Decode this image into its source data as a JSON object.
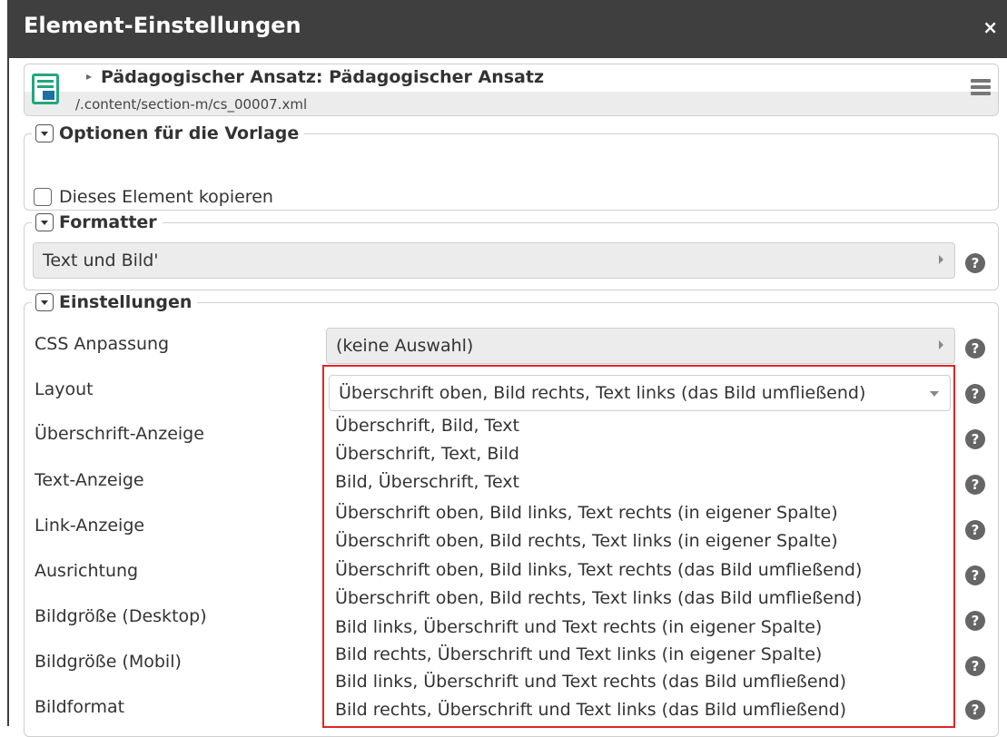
{
  "dialog": {
    "title": "Element-Einstellungen",
    "close_glyph": "×"
  },
  "element": {
    "icon": "text-image-element-icon",
    "arrow_glyph": "▸",
    "heading": "Pädagogischer Ansatz: Pädagogischer Ansatz",
    "path": "/.content/section-m/cs_00007.xml",
    "menu_icon": "hamburger-menu-icon"
  },
  "options_group": {
    "legend": "Optionen für die Vorlage",
    "copy_checkbox": {
      "label": "Dieses Element kopieren",
      "checked": false
    }
  },
  "formatter_group": {
    "legend": "Formatter",
    "selected": "Text und Bild'"
  },
  "settings_group": {
    "legend": "Einstellungen",
    "rows": [
      {
        "label": "CSS Anpassung",
        "value": "(keine Auswahl)"
      },
      {
        "label": "Layout",
        "value": "Überschrift oben, Bild rechts, Text links (das Bild umfließend)"
      },
      {
        "label": "Überschrift-Anzeige"
      },
      {
        "label": "Text-Anzeige"
      },
      {
        "label": "Link-Anzeige"
      },
      {
        "label": "Ausrichtung"
      },
      {
        "label": "Bildgröße (Desktop)"
      },
      {
        "label": "Bildgröße (Mobil)"
      },
      {
        "label": "Bildformat"
      }
    ],
    "layout_options": [
      "Überschrift, Bild, Text",
      "Überschrift, Text, Bild",
      "Bild, Überschrift, Text",
      "Überschrift oben, Bild links, Text rechts (in eigener Spalte)",
      "Überschrift oben, Bild rechts, Text links (in eigener Spalte)",
      "Überschrift oben, Bild links, Text rechts (das Bild umfließend)",
      "Überschrift oben, Bild rechts, Text links (das Bild umfließend)",
      "Bild links, Überschrift und Text rechts (in eigener Spalte)",
      "Bild rechts, Überschrift und Text links (in eigener Spalte)",
      "Bild links, Überschrift und Text rechts (das Bild umfließend)",
      "Bild rechts, Überschrift und Text links (das Bild umfließend)"
    ],
    "help_glyph": "?"
  },
  "colors": {
    "titlebar": "#3f3f3f",
    "accent_icon": "#21a77d",
    "highlight_border": "#e0242a",
    "select_bg": "#ececec"
  }
}
